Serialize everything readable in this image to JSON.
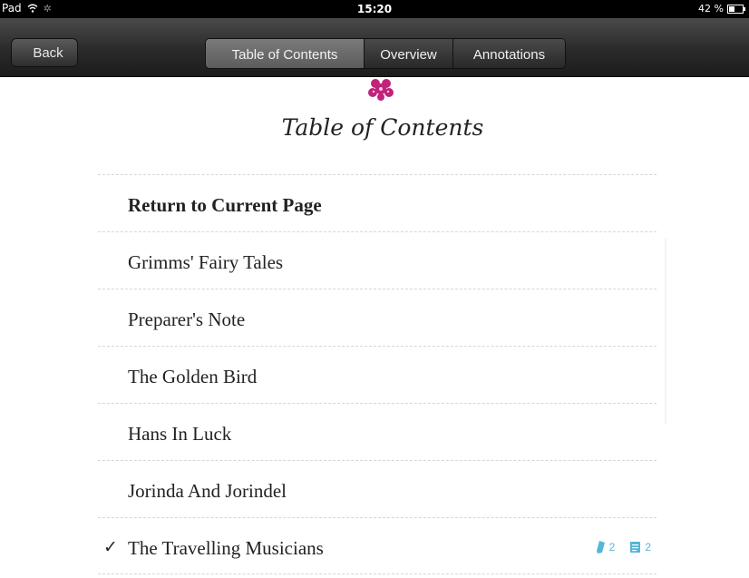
{
  "status_bar": {
    "device": "Pad",
    "time": "15:20",
    "battery": "42 %",
    "battery_level": 0.42
  },
  "nav": {
    "back_label": "Back",
    "segments": [
      {
        "label": "Table of Contents",
        "selected": true
      },
      {
        "label": "Overview",
        "selected": false
      },
      {
        "label": "Annotations",
        "selected": false
      }
    ]
  },
  "content": {
    "title": "Table of Contents",
    "items": [
      {
        "label": "Return to Current Page",
        "bold": true
      },
      {
        "label": "Grimms' Fairy Tales"
      },
      {
        "label": "Preparer's Note"
      },
      {
        "label": "The Golden Bird"
      },
      {
        "label": "Hans In Luck"
      },
      {
        "label": "Jorinda And Jorindel"
      },
      {
        "label": "The Travelling Musicians",
        "checked": true,
        "highlights": "2",
        "notes": "2"
      }
    ]
  },
  "icons": {
    "ornament": "flower-ornament-icon",
    "check": "✓",
    "highlight": "highlighter-icon",
    "note": "note-icon"
  },
  "colors": {
    "ornament": "#c2237a",
    "badge": "#56b6d6",
    "navbar": "#2a2a2a"
  }
}
